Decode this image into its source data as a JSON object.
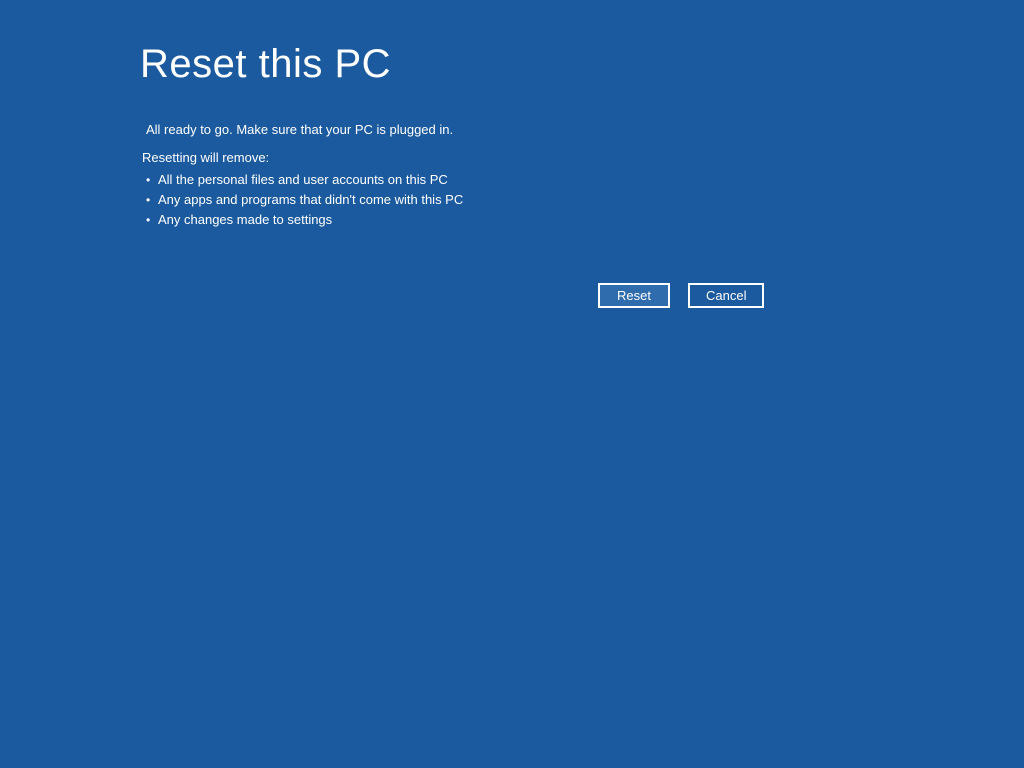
{
  "title": "Reset this PC",
  "status": "All ready to go. Make sure that your PC is plugged in.",
  "removal_header": "Resetting will remove:",
  "removal_items": [
    "All the personal files and user accounts on this PC",
    "Any apps and programs that didn't come with this PC",
    "Any changes made to settings"
  ],
  "buttons": {
    "reset": "Reset",
    "cancel": "Cancel"
  }
}
